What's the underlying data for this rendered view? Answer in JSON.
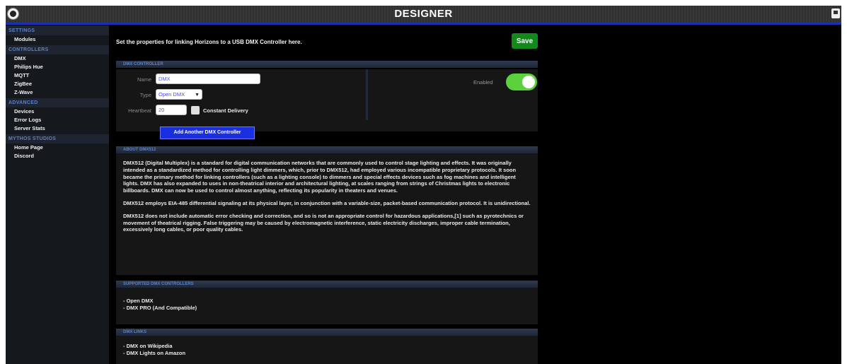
{
  "app": {
    "title": "DESIGNER",
    "accent": "#1c2fb0"
  },
  "sidebar": {
    "sections": [
      {
        "header": "SETTINGS",
        "items": [
          "Modules"
        ]
      },
      {
        "header": "CONTROLLERS",
        "items": [
          "DMX",
          "Philips Hue",
          "MQTT",
          "ZigBee",
          "Z-Wave"
        ]
      },
      {
        "header": "ADVANCED",
        "items": [
          "Devices",
          "Error Logs",
          "Server Stats"
        ]
      },
      {
        "header": "MYTHOS STUDIOS",
        "items": [
          "Home Page",
          "Discord"
        ]
      }
    ]
  },
  "main": {
    "intro": "Set the properties for linking Horizons to a USB DMX Controller here.",
    "save_label": "Save",
    "dmx_section": {
      "header": "DMX CONTROLLER",
      "name_label": "Name",
      "name_value": "DMX",
      "type_label": "Type",
      "type_value": "Open DMX",
      "heartbeat_label": "Heartbeat",
      "heartbeat_value": "20",
      "constant_delivery_label": "Constant Delivery",
      "constant_delivery_checked": false,
      "enabled_label": "Enabled",
      "enabled": true,
      "add_button": "Add Another DMX Controller"
    },
    "about": {
      "header": "ABOUT DMX512",
      "paragraphs": [
        "DMX512 (Digital Multiplex) is a standard for digital communication networks that are commonly used to control stage lighting and effects. It was originally intended as a standardized method for controlling light dimmers, which, prior to DMX512, had employed various incompatible proprietary protocols. It soon became the primary method for linking controllers (such as a lighting console) to dimmers and special effects devices such as fog machines and intelligent lights. DMX has also expanded to uses in non-theatrical interior and architectural lighting, at scales ranging from strings of Christmas lights to electronic billboards. DMX can now be used to control almost anything, reflecting its popularity in theaters and venues.",
        "DMX512 employs EIA-485 differential signaling at its physical layer, in conjunction with a variable-size, packet-based communication protocol. It is unidirectional.",
        "DMX512 does not include automatic error checking and correction, and so is not an appropriate control for hazardous applications,[1] such as pyrotechnics or movement of theatrical rigging. False triggering may be caused by electromagnetic interference, static electricity discharges, improper cable termination, excessively long cables, or poor quality cables."
      ]
    },
    "supported": {
      "header": "SUPPORTED DMX CONTROLLERS",
      "items": [
        "- Open DMX",
        "- DMX PRO (And Compatible)"
      ]
    },
    "links": {
      "header": "DMX LINKS",
      "items": [
        "- DMX on Wikipedia",
        "- DMX Lights on Amazon"
      ]
    }
  }
}
